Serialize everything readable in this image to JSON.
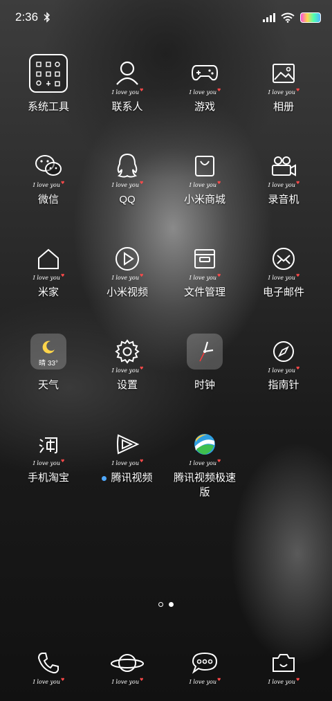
{
  "status": {
    "time": "2:36"
  },
  "tagline": "I love you",
  "apps": [
    {
      "label": "系统工具",
      "icon": "folder-icon"
    },
    {
      "label": "联系人",
      "icon": "contacts-icon"
    },
    {
      "label": "游戏",
      "icon": "gamepad-icon"
    },
    {
      "label": "相册",
      "icon": "gallery-icon"
    },
    {
      "label": "微信",
      "icon": "wechat-icon"
    },
    {
      "label": "QQ",
      "icon": "qq-icon"
    },
    {
      "label": "小米商城",
      "icon": "shopping-bag-icon"
    },
    {
      "label": "录音机",
      "icon": "recorder-icon"
    },
    {
      "label": "米家",
      "icon": "home-icon"
    },
    {
      "label": "小米视频",
      "icon": "play-icon"
    },
    {
      "label": "文件管理",
      "icon": "file-manager-icon"
    },
    {
      "label": "电子邮件",
      "icon": "mail-icon"
    },
    {
      "label": "天气",
      "icon": "weather-icon",
      "badge": "晴 33°"
    },
    {
      "label": "设置",
      "icon": "gear-icon"
    },
    {
      "label": "时钟",
      "icon": "clock-icon"
    },
    {
      "label": "指南针",
      "icon": "compass-icon"
    },
    {
      "label": "手机淘宝",
      "icon": "taobao-icon"
    },
    {
      "label": "腾讯视频",
      "icon": "tencent-video-icon",
      "new": true
    },
    {
      "label": "腾讯视频极速版",
      "icon": "tencent-video-lite-icon"
    }
  ],
  "dock": [
    {
      "name": "phone",
      "icon": "phone-icon"
    },
    {
      "name": "browser",
      "icon": "planet-icon"
    },
    {
      "name": "messages",
      "icon": "message-icon"
    },
    {
      "name": "camera",
      "icon": "camera-icon"
    }
  ],
  "pager": {
    "pages": 2,
    "current": 2
  }
}
